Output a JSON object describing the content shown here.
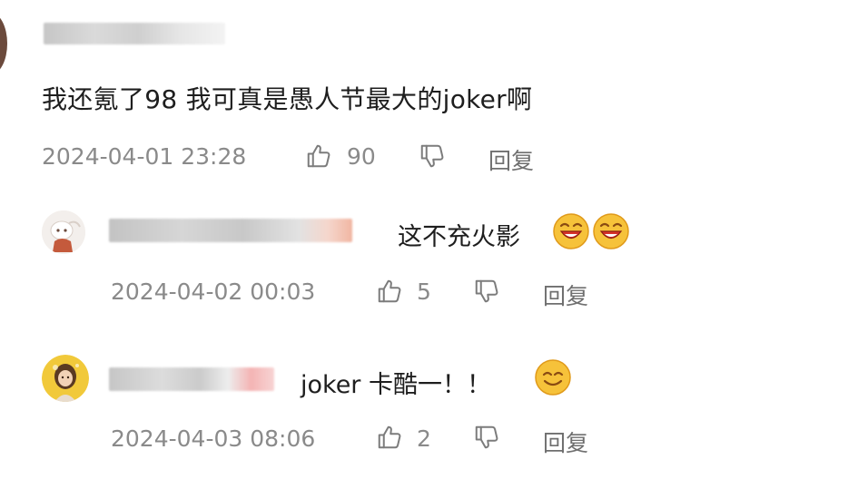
{
  "comment": {
    "text": "我还氪了98 我可真是愚人节最大的joker啊",
    "timestamp": "2024-04-01 23:28",
    "like_count": "90",
    "reply_label": "回复",
    "like_icon": "thumbs-up-icon",
    "dislike_icon": "thumbs-down-icon"
  },
  "replies": [
    {
      "text": "这不充火影",
      "emojis": [
        "laughing-face-emoji",
        "laughing-face-emoji"
      ],
      "timestamp": "2024-04-02 00:03",
      "like_count": "5",
      "reply_label": "回复"
    },
    {
      "text": "joker 卡酷一！！",
      "emojis": [
        "smiling-face-emoji"
      ],
      "timestamp": "2024-04-03 08:06",
      "like_count": "2",
      "reply_label": "回复"
    }
  ],
  "colors": {
    "text": "#1e1e1e",
    "meta": "#8a8a8a",
    "background": "#ffffff",
    "emoji_yellow": "#f6c23a",
    "emoji_red": "#d8322a"
  }
}
